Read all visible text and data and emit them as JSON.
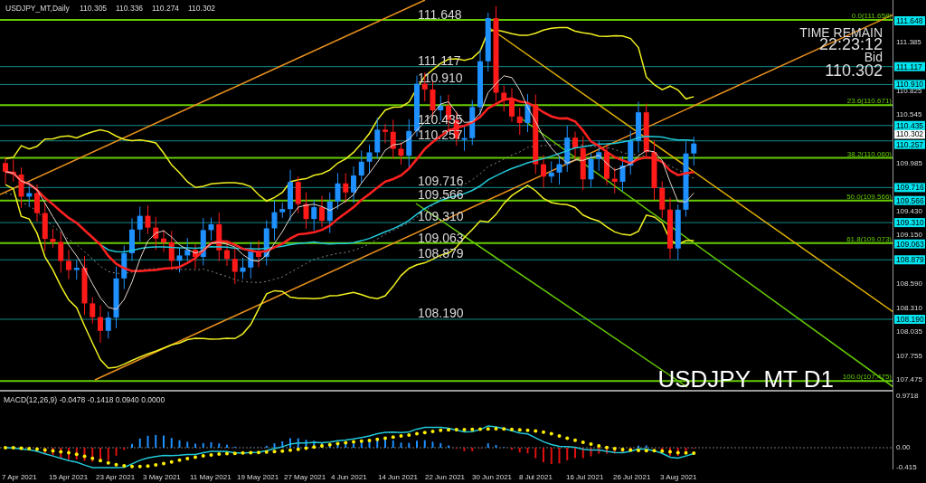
{
  "header": {
    "symbol": "USDJPY_MT,Daily",
    "quote": [
      "110.305",
      "110.336",
      "110.274",
      "110.302"
    ]
  },
  "timer": {
    "label": "TIME REMAIN",
    "time": "22:23:12",
    "bid_label": "Bid",
    "bid": "110.302"
  },
  "chart_label": "USDJPY_MT D1",
  "levels": [
    {
      "left_label": "111.648",
      "tag": "111.648"
    },
    {
      "left_label": "111.117",
      "tag": "111.117"
    },
    {
      "left_label": "110.910",
      "tag": "110.910"
    },
    {
      "left_label": "110.435",
      "tag": "110.435"
    },
    {
      "left_label": "110.257",
      "tag": "110.257"
    },
    {
      "left_label": "109.716",
      "tag": "109.716"
    },
    {
      "left_label": "109.566",
      "tag": "109.566"
    },
    {
      "left_label": "109.310",
      "tag": "109.310"
    },
    {
      "left_label": "109.063",
      "tag": "109.063"
    },
    {
      "left_label": "108.879",
      "tag": "108.879"
    },
    {
      "left_label": "108.190",
      "tag": "108.190"
    }
  ],
  "fibonacci": [
    {
      "label": "0.0(111.658)"
    },
    {
      "label": "23.6(110.671)"
    },
    {
      "label": "38.2(110.060)"
    },
    {
      "label": "50.0(109.566)"
    },
    {
      "label": "61.8(109.073)"
    },
    {
      "label": "100.0(107.475)"
    }
  ],
  "bid_tag": "110.302",
  "price_axis": [
    "111.385",
    "110.825",
    "110.545",
    "109.985",
    "109.430",
    "109.150",
    "108.590",
    "108.310",
    "108.035",
    "107.755",
    "107.475"
  ],
  "macd": {
    "label": "MACD(12,26,9) -0.0478 -0.1418 0.0940 0.0000",
    "axis": [
      "0.9718",
      "0.00",
      "-0.415"
    ]
  },
  "dates": [
    "7 Apr 2021",
    "15 Apr 2021",
    "23 Apr 2021",
    "3 May 2021",
    "11 May 2021",
    "19 May 2021",
    "27 May 2021",
    "4 Jun 2021",
    "14 Jun 2021",
    "22 Jun 2021",
    "30 Jun 2021",
    "8 Jul 2021",
    "16 Jul 2021",
    "26 Jul 2021",
    "3 Aug 2021"
  ]
}
